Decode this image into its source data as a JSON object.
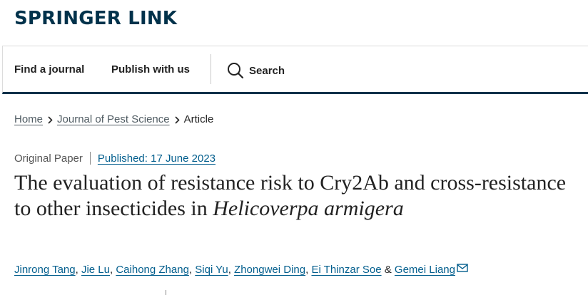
{
  "header": {
    "logo_text": "SPRINGER LINK"
  },
  "nav": {
    "find_journal": "Find a journal",
    "publish": "Publish with us",
    "search": "Search"
  },
  "breadcrumb": {
    "home": "Home",
    "journal": "Journal of Pest Science",
    "current": "Article"
  },
  "article": {
    "type": "Original Paper",
    "published": "Published: 17 June 2023",
    "title_main": "The evaluation of resistance risk to Cry2Ab and cross-resistance to other insecticides in ",
    "title_species": "Helicoverpa armigera",
    "authors": [
      "Jinrong Tang",
      "Jie Lu",
      "Caihong Zhang",
      "Siqi Yu",
      "Zhongwei Ding",
      "Ei Thinzar Soe",
      "Gemei Liang"
    ],
    "author_separator": ",",
    "author_last_separator": "&"
  },
  "colors": {
    "brand_navy": "#01324b",
    "link_blue": "#025e8d",
    "text": "#222222"
  },
  "icons": {
    "search": "search-icon",
    "chevron": "chevron-right-icon",
    "email": "mail-icon"
  }
}
